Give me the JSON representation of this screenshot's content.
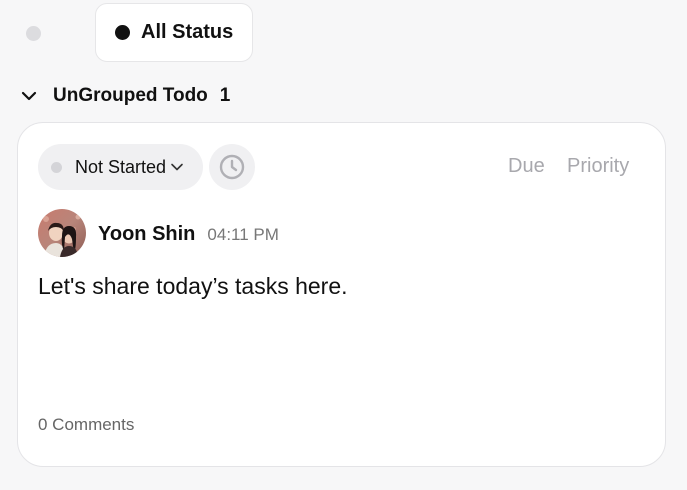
{
  "filter": {
    "status_label": "All Status"
  },
  "group": {
    "title": "UnGrouped Todo",
    "count": "1"
  },
  "todo": {
    "status": "Not Started",
    "due_label": "Due",
    "priority_label": "Priority",
    "author": "Yoon Shin",
    "time": "04:11 PM",
    "text": "Let's share today’s tasks here.",
    "comments": "0 Comments"
  },
  "icons": {
    "collapse": "chevron-down-icon",
    "status_dropdown": "chevron-down-icon",
    "time": "clock-icon"
  },
  "colors": {
    "status_active_dot": "#111111",
    "status_not_started_dot": "#d4d4d8",
    "muted_text": "#a8a8ad"
  }
}
